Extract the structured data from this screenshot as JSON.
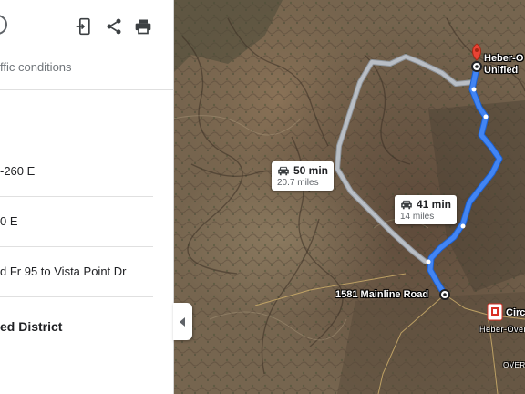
{
  "panel": {
    "traffic_text": "ffic conditions",
    "steps": [
      {
        "text": "-260 E"
      },
      {
        "text": "0 E"
      },
      {
        "text": "d Fr 95 to Vista Point Dr"
      }
    ],
    "district_text": "ed District",
    "icons": [
      "send-to-device-icon",
      "share-icon",
      "print-icon"
    ]
  },
  "map": {
    "routes": [
      {
        "mode": "car",
        "time": "50 min",
        "distance": "20.7 miles",
        "selected": false
      },
      {
        "mode": "car",
        "time": "41 min",
        "distance": "14 miles",
        "selected": true
      }
    ],
    "destination_label_line1": "Heber-O",
    "destination_label_line2": "Unified",
    "origin_label": "1581 Mainline Road",
    "poi_label": "Circ",
    "town_label": "Heber-Over",
    "road_label": "OVER",
    "colors": {
      "route_selected": "#4285f4",
      "route_alternate": "#b9bec5",
      "destination_pin": "#ea4335"
    }
  }
}
